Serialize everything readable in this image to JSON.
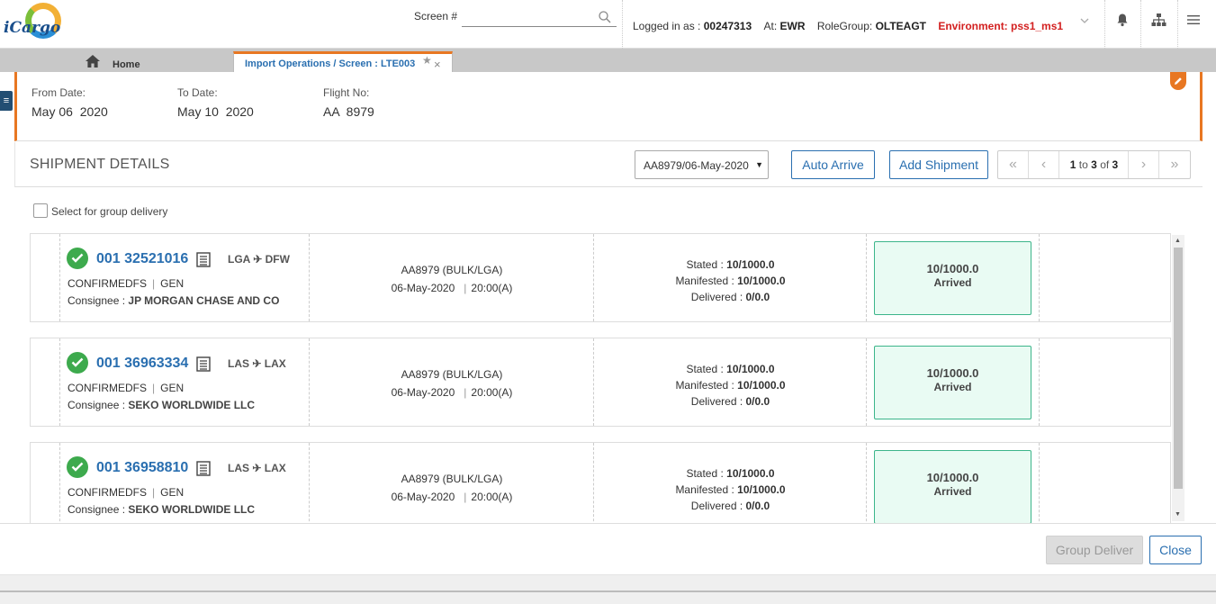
{
  "app": {
    "logo_text": "iCargo"
  },
  "top": {
    "screen_label": "Screen #",
    "screen_value": "",
    "login_prefix": "Logged in as :",
    "user": "00247313",
    "at_label": "At:",
    "station": "EWR",
    "rolegroup_label": "RoleGroup:",
    "rolegroup": "OLTEAGT",
    "environment": "Environment: pss1_ms1"
  },
  "tabs": {
    "home": "Home",
    "active": "Import Operations / Screen : LTE003"
  },
  "header": {
    "from_label": "From Date:",
    "from_value": "May 06  2020",
    "to_label": "To Date:",
    "to_value": "May 10  2020",
    "flight_label": "Flight No:",
    "flight_value": "AA  8979"
  },
  "shipments_panel": {
    "title": "SHIPMENT DETAILS",
    "flight_select": "AA8979/06-May-2020",
    "auto_arrive": "Auto Arrive",
    "add_shipment": "Add Shipment",
    "pager": {
      "from": "1",
      "to_word": "to",
      "to": "3",
      "of_word": "of",
      "total": "3"
    },
    "group_delivery_label": "Select for group delivery"
  },
  "shipments": [
    {
      "awb": "001 32521016",
      "origin": "LGA",
      "destination": "DFW",
      "status": "CONFIRMEDFS",
      "commodity": "GEN",
      "consignee_label": "Consignee :",
      "consignee": "JP MORGAN CHASE AND CO",
      "flight": "AA8979 (BULK/LGA)",
      "date": "06-May-2020",
      "time": "20:00(A)",
      "stated_label": "Stated :",
      "stated": "10/1000.0",
      "manifested_label": "Manifested :",
      "manifested": "10/1000.0",
      "delivered_label": "Delivered :",
      "delivered": "0/0.0",
      "arrived_qty": "10/1000.0",
      "arrived_status": "Arrived"
    },
    {
      "awb": "001 36963334",
      "origin": "LAS",
      "destination": "LAX",
      "status": "CONFIRMEDFS",
      "commodity": "GEN",
      "consignee_label": "Consignee :",
      "consignee": "SEKO WORLDWIDE LLC",
      "flight": "AA8979 (BULK/LGA)",
      "date": "06-May-2020",
      "time": "20:00(A)",
      "stated_label": "Stated :",
      "stated": "10/1000.0",
      "manifested_label": "Manifested :",
      "manifested": "10/1000.0",
      "delivered_label": "Delivered :",
      "delivered": "0/0.0",
      "arrived_qty": "10/1000.0",
      "arrived_status": "Arrived"
    },
    {
      "awb": "001 36958810",
      "origin": "LAS",
      "destination": "LAX",
      "status": "CONFIRMEDFS",
      "commodity": "GEN",
      "consignee_label": "Consignee :",
      "consignee": "SEKO WORLDWIDE LLC",
      "flight": "AA8979 (BULK/LGA)",
      "date": "06-May-2020",
      "time": "20:00(A)",
      "stated_label": "Stated :",
      "stated": "10/1000.0",
      "manifested_label": "Manifested :",
      "manifested": "10/1000.0",
      "delivered_label": "Delivered :",
      "delivered": "0/0.0",
      "arrived_qty": "10/1000.0",
      "arrived_status": "Arrived"
    }
  ],
  "footer": {
    "group_deliver": "Group Deliver",
    "close": "Close"
  },
  "colors": {
    "accent": "#e87722",
    "link": "#2a6fb0",
    "success": "#3daa4d",
    "environment": "#d32020",
    "arrived_bg": "#e9fbf3"
  }
}
